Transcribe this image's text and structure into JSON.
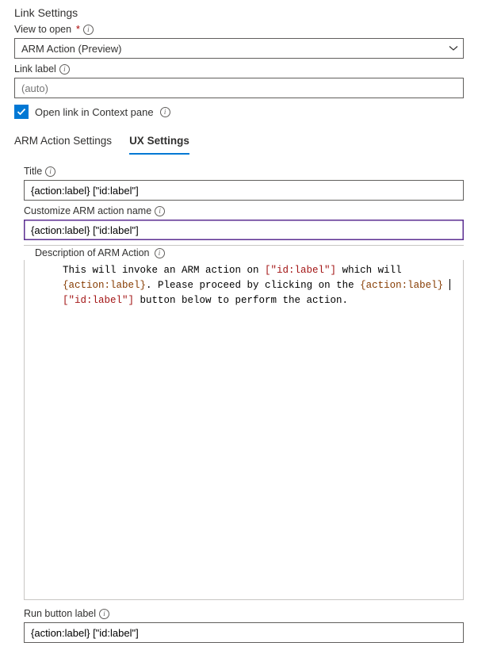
{
  "header": {
    "title": "Link Settings"
  },
  "fields": {
    "viewToOpen": {
      "label": "View to open",
      "required": "*",
      "value": "ARM Action (Preview)"
    },
    "linkLabel": {
      "label": "Link label",
      "placeholder": "(auto)",
      "value": ""
    },
    "checkbox": {
      "label": "Open link in Context pane",
      "checked": true
    }
  },
  "tabs": {
    "armSettings": "ARM Action Settings",
    "uxSettings": "UX Settings"
  },
  "ux": {
    "title": {
      "label": "Title",
      "value": "{action:label} [\"id:label\"]"
    },
    "customize": {
      "label": "Customize ARM action name",
      "value": "{action:label} [\"id:label\"]"
    },
    "description": {
      "label": "Description of ARM Action",
      "text_pre": "This will invoke an ARM action on ",
      "idlabel1": "[\"id:label\"]",
      "text_mid1": " which will ",
      "actionlabel1": "{action:label}",
      "text_mid2": ". Please proceed by clicking on the ",
      "actionlabel2": "{action:label}",
      "idlabel2": "[\"id:label\"]",
      "text_end": " button below to perform the action."
    },
    "runButton": {
      "label": "Run button label",
      "value": "{action:label} [\"id:label\"]"
    }
  }
}
